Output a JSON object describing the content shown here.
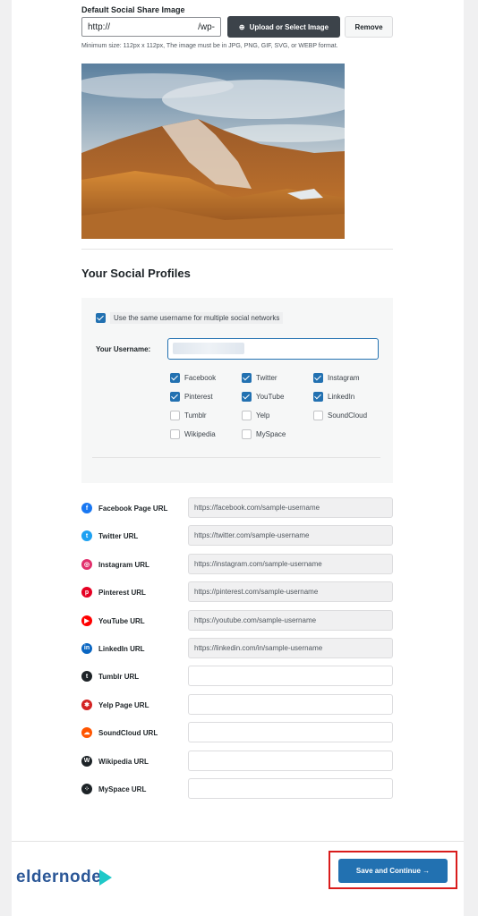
{
  "share_image": {
    "label": "Default Social Share Image",
    "url_value_start": "http://",
    "url_value_end": "/wp-",
    "upload_label": "Upload or Select Image",
    "remove_label": "Remove",
    "hint": "Minimum size: 112px x 112px, The image must be in JPG, PNG, GIF, SVG, or WEBP format."
  },
  "profiles": {
    "title": "Your Social Profiles",
    "same_username_label": "Use the same username for multiple social networks",
    "same_username_checked": true,
    "username_label": "Your Username:",
    "networks": [
      {
        "label": "Facebook",
        "checked": true
      },
      {
        "label": "Twitter",
        "checked": true
      },
      {
        "label": "Instagram",
        "checked": true
      },
      {
        "label": "Pinterest",
        "checked": true
      },
      {
        "label": "YouTube",
        "checked": true
      },
      {
        "label": "LinkedIn",
        "checked": true
      },
      {
        "label": "Tumblr",
        "checked": false
      },
      {
        "label": "Yelp",
        "checked": false
      },
      {
        "label": "SoundCloud",
        "checked": false
      },
      {
        "label": "Wikipedia",
        "checked": false
      },
      {
        "label": "MySpace",
        "checked": false
      }
    ]
  },
  "social_urls": [
    {
      "label": "Facebook Page URL",
      "value": "https://facebook.com/sample-username",
      "icon": "facebook-icon",
      "color": "#1877f2",
      "glyph": "f"
    },
    {
      "label": "Twitter URL",
      "value": "https://twitter.com/sample-username",
      "icon": "twitter-icon",
      "color": "#1da1f2",
      "glyph": "t"
    },
    {
      "label": "Instagram URL",
      "value": "https://instagram.com/sample-username",
      "icon": "instagram-icon",
      "color": "#e1306c",
      "glyph": "◎"
    },
    {
      "label": "Pinterest URL",
      "value": "https://pinterest.com/sample-username",
      "icon": "pinterest-icon",
      "color": "#e60023",
      "glyph": "p"
    },
    {
      "label": "YouTube URL",
      "value": "https://youtube.com/sample-username",
      "icon": "youtube-icon",
      "color": "#ff0000",
      "glyph": "▶"
    },
    {
      "label": "LinkedIn URL",
      "value": "https://linkedin.com/in/sample-username",
      "icon": "linkedin-icon",
      "color": "#0a66c2",
      "glyph": "in"
    },
    {
      "label": "Tumblr URL",
      "value": "",
      "icon": "tumblr-icon",
      "color": "#1d2327",
      "glyph": "t"
    },
    {
      "label": "Yelp Page URL",
      "value": "",
      "icon": "yelp-icon",
      "color": "#d32323",
      "glyph": "✱"
    },
    {
      "label": "SoundCloud URL",
      "value": "",
      "icon": "soundcloud-icon",
      "color": "#ff5500",
      "glyph": "☁"
    },
    {
      "label": "Wikipedia URL",
      "value": "",
      "icon": "wikipedia-icon",
      "color": "#1d2327",
      "glyph": "W"
    },
    {
      "label": "MySpace URL",
      "value": "",
      "icon": "myspace-icon",
      "color": "#1d2327",
      "glyph": "⁘"
    }
  ],
  "footer": {
    "logo_text": "eldernode",
    "save_label": "Save and Continue →"
  }
}
